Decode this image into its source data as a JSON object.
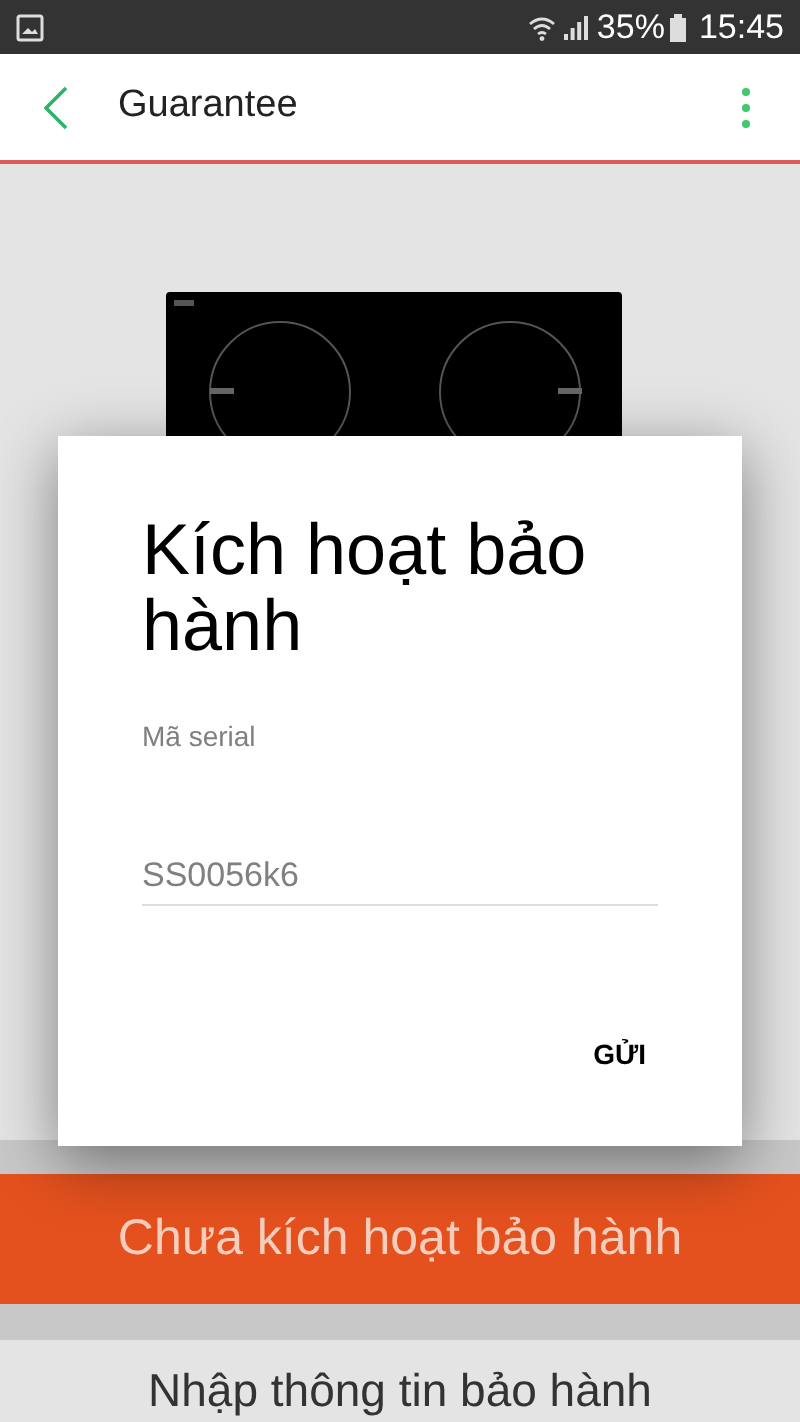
{
  "status_bar": {
    "battery": "35%",
    "time": "15:45"
  },
  "app_bar": {
    "title": "Guarantee"
  },
  "page": {
    "status_banner": "Chưa kích hoạt bảo hành",
    "enter_info": "Nhập thông tin bảo hành"
  },
  "dialog": {
    "title": "Kích hoạt bảo hành",
    "field_label": "Mã serial",
    "field": {
      "placeholder": "SS0056k6"
    },
    "buttons": [
      "GỬI"
    ]
  }
}
